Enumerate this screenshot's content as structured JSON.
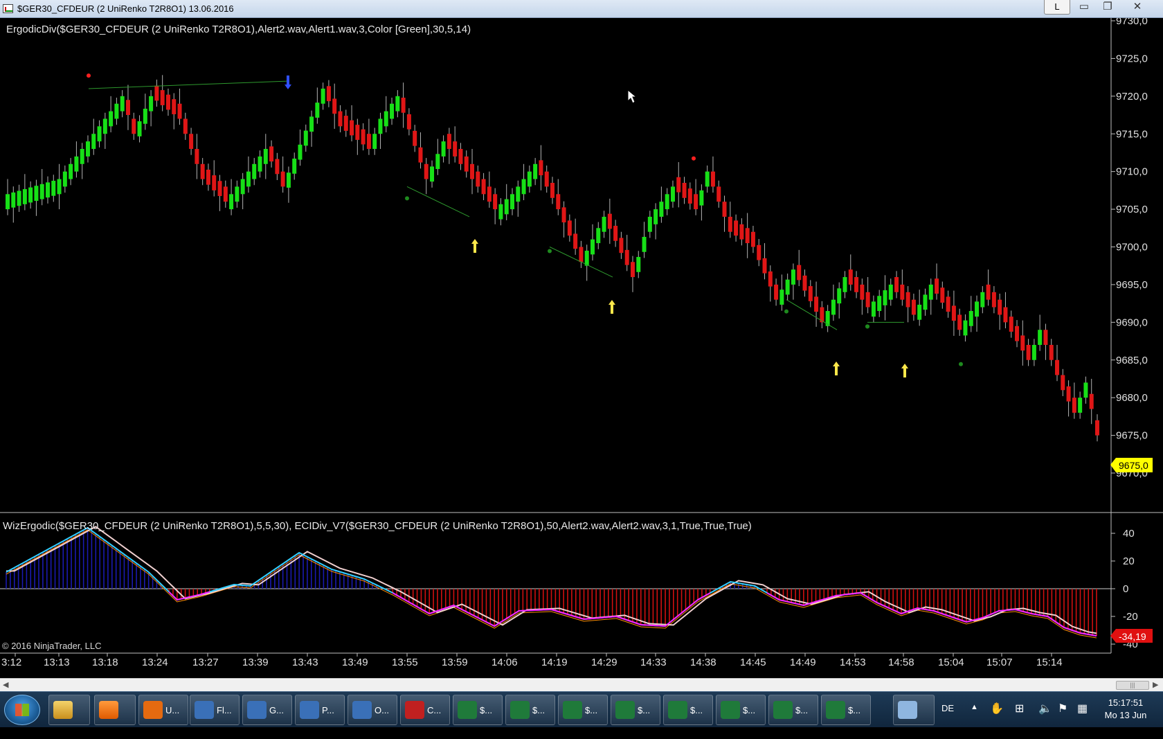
{
  "window": {
    "title": "$GER30_CFDEUR (2 UniRenko T2R8O1)  13.06.2016",
    "l_button": "L",
    "minimize_glyph": "▭",
    "restore_glyph": "❐",
    "close_glyph": "✕"
  },
  "price_panel": {
    "indicator_label": "ErgodicDiv($GER30_CFDEUR  (2  UniRenko  T2R8O1),Alert2.wav,Alert1.wav,3,Color  [Green],30,5,14)",
    "axis_ticks": [
      "9730,0",
      "9725,0",
      "9720,0",
      "9715,0",
      "9710,0",
      "9705,0",
      "9700,0",
      "9695,0",
      "9690,0",
      "9685,0",
      "9680,0",
      "9675,0",
      "9670,0"
    ],
    "last_price": "9675,0"
  },
  "osc_panel": {
    "indicator_label": "WizErgodic($GER30_CFDEUR  (2  UniRenko  T2R8O1),5,5,30),  ECIDiv_V7($GER30_CFDEUR  (2  UniRenko  T2R8O1),50,Alert2.wav,Alert2.wav,3,1,True,True,True)",
    "axis_ticks": [
      "40",
      "20",
      "0",
      "-20",
      "-40"
    ],
    "last_value": "-34,19"
  },
  "copyright": "© 2016 NinjaTrader, LLC",
  "time_axis": [
    "3:12",
    "13:13",
    "13:18",
    "13:24",
    "13:27",
    "13:39",
    "13:43",
    "13:49",
    "13:55",
    "13:59",
    "14:06",
    "14:19",
    "14:29",
    "14:33",
    "14:38",
    "14:45",
    "14:49",
    "14:53",
    "14:58",
    "15:04",
    "15:07",
    "15:14"
  ],
  "chart_data": {
    "type": "candlestick",
    "price_axis": {
      "min": 9670,
      "max": 9730,
      "step": 5
    },
    "last_price": 9675.0,
    "close_path": [
      [
        0,
        9707
      ],
      [
        9,
        9709
      ],
      [
        20,
        9720
      ],
      [
        22,
        9715
      ],
      [
        25,
        9720
      ],
      [
        30,
        9717
      ],
      [
        34,
        9709
      ],
      [
        38,
        9706
      ],
      [
        45,
        9713
      ],
      [
        48,
        9708
      ],
      [
        55,
        9721
      ],
      [
        58,
        9716
      ],
      [
        63,
        9713
      ],
      [
        65,
        9717
      ],
      [
        68,
        9720
      ],
      [
        73,
        9709
      ],
      [
        76,
        9714
      ],
      [
        80,
        9710
      ],
      [
        85,
        9705
      ],
      [
        88,
        9707
      ],
      [
        92,
        9711
      ],
      [
        96,
        9705
      ],
      [
        100,
        9698
      ],
      [
        104,
        9704
      ],
      [
        109,
        9696
      ],
      [
        112,
        9704
      ],
      [
        116,
        9708
      ],
      [
        120,
        9705
      ],
      [
        122,
        9710
      ],
      [
        126,
        9702
      ],
      [
        130,
        9700
      ],
      [
        134,
        9693
      ],
      [
        137,
        9697
      ],
      [
        142,
        9690
      ],
      [
        146,
        9696
      ],
      [
        150,
        9692
      ],
      [
        154,
        9695
      ],
      [
        158,
        9691
      ],
      [
        161,
        9695
      ],
      [
        166,
        9689
      ],
      [
        170,
        9694
      ],
      [
        174,
        9690
      ],
      [
        178,
        9685
      ],
      [
        180,
        9689
      ],
      [
        184,
        9681
      ],
      [
        186,
        9678
      ],
      [
        188,
        9682
      ],
      [
        190,
        9675
      ]
    ],
    "swing_markers": {
      "red_dots": [
        9722,
        9711
      ],
      "green_dots": [
        9707,
        9700,
        9692,
        9690,
        9690,
        9685
      ]
    },
    "divergence_lines": [
      {
        "color": "green",
        "from": 9721,
        "to": 9722
      },
      {
        "color": "green",
        "from": 9708,
        "to": 9704
      },
      {
        "color": "green",
        "from": 9700,
        "to": 9696
      },
      {
        "color": "green",
        "from": 9693,
        "to": 9689
      },
      {
        "color": "green",
        "from": 9690,
        "to": 9690
      }
    ],
    "arrows": [
      {
        "direction": "down",
        "color": "blue"
      },
      {
        "direction": "up",
        "color": "yellow"
      },
      {
        "direction": "up",
        "color": "yellow"
      },
      {
        "direction": "up",
        "color": "yellow"
      },
      {
        "direction": "up",
        "color": "yellow"
      }
    ],
    "oscillator": {
      "axis": {
        "min": -40,
        "max": 40
      },
      "last_value": -34.19,
      "signal_path": [
        [
          0,
          12
        ],
        [
          20,
          44
        ],
        [
          35,
          12
        ],
        [
          42,
          -8
        ],
        [
          48,
          -4
        ],
        [
          56,
          3
        ],
        [
          60,
          2
        ],
        [
          72,
          26
        ],
        [
          80,
          14
        ],
        [
          88,
          7
        ],
        [
          95,
          -3
        ],
        [
          104,
          -18
        ],
        [
          110,
          -12
        ],
        [
          120,
          -27
        ],
        [
          126,
          -16
        ],
        [
          134,
          -15
        ],
        [
          142,
          -22
        ],
        [
          150,
          -20
        ],
        [
          156,
          -26
        ],
        [
          162,
          -27
        ],
        [
          170,
          -8
        ],
        [
          178,
          5
        ],
        [
          184,
          2
        ],
        [
          190,
          -8
        ],
        [
          196,
          -12
        ],
        [
          204,
          -5
        ],
        [
          210,
          -3
        ],
        [
          214,
          -10
        ],
        [
          220,
          -18
        ],
        [
          224,
          -14
        ],
        [
          228,
          -16
        ],
        [
          232,
          -20
        ],
        [
          236,
          -24
        ],
        [
          240,
          -21
        ],
        [
          244,
          -16
        ],
        [
          248,
          -15
        ],
        [
          252,
          -18
        ],
        [
          256,
          -20
        ],
        [
          260,
          -28
        ],
        [
          264,
          -32
        ],
        [
          268,
          -34
        ]
      ],
      "bullish_color": "#1a1ab0",
      "bearish_color": "#d01010"
    },
    "colors": {
      "up_candle": "#17e017",
      "down_candle": "#e01616",
      "wick": "#b4b4b4"
    }
  },
  "taskbar": {
    "items": [
      "U...",
      "Fl...",
      "G...",
      "P...",
      "O...",
      "C...",
      "$...",
      "$...",
      "$...",
      "$...",
      "$...",
      "$...",
      "$...",
      "$..."
    ],
    "language": "DE",
    "time": "15:17:51",
    "date": "Mo 13 Jun"
  }
}
